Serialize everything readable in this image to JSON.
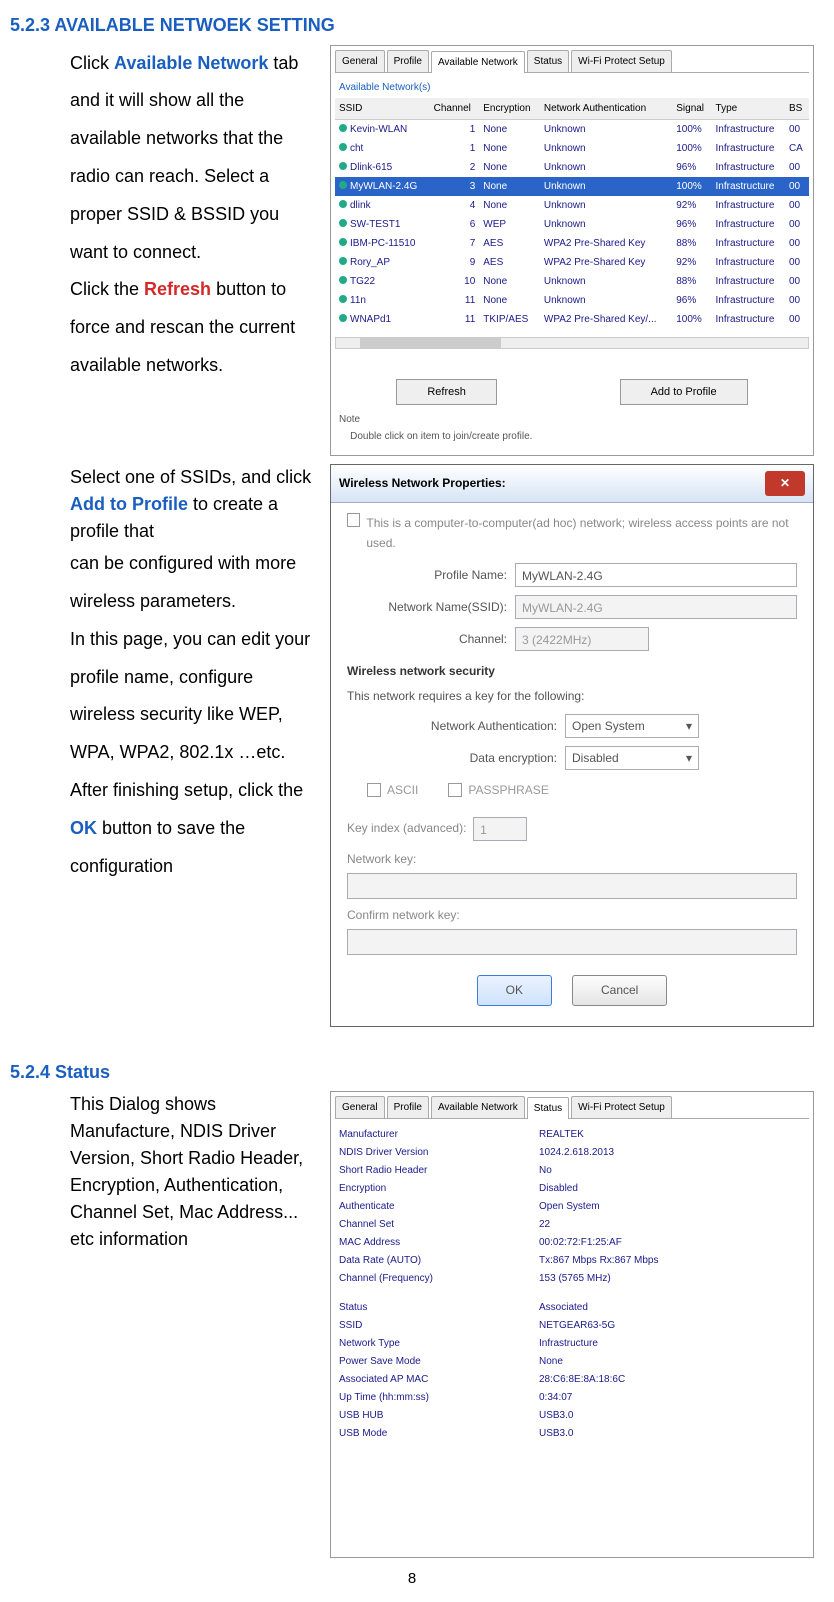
{
  "sec1_title": "5.2.3 AVAILABLE NETWOEK SETTING",
  "p1": {
    "pre": "Click ",
    "kw1": "Available Network",
    "mid1": " tab and it will show all the available networks that the radio can reach. Select a proper SSID & BSSID you want to connect.",
    "click_the": "Click the ",
    "kw2": "Refresh",
    "mid2": " button to force and rescan the current available networks."
  },
  "p2": {
    "a": "Select one of SSIDs, and click ",
    "kw": "Add to Profile",
    "b": " to create a profile that",
    "c": "can be configured with more wireless parameters.",
    "d": "In this page, you can edit your profile name, configure wireless security like WEP, WPA, WPA2, 802.1x …etc. After finishing setup, click the ",
    "ok": "OK",
    "e": " button to save the configuration"
  },
  "sec2_title": "5.2.4 Status",
  "p3": "This Dialog shows Manufacture, NDIS Driver Version, Short Radio Header, Encryption, Authentication, Channel Set, Mac Address... etc information",
  "img1": {
    "tabs": {
      "general": "General",
      "profile": "Profile",
      "avail": "Available Network",
      "status": "Status",
      "wps": "Wi-Fi Protect Setup"
    },
    "avail_label": "Available Network(s)",
    "headers": {
      "ssid": "SSID",
      "channel": "Channel",
      "enc": "Encryption",
      "auth": "Network Authentication",
      "signal": "Signal",
      "type": "Type",
      "bs": "BS"
    },
    "rows": [
      {
        "ssid": "Kevin-WLAN",
        "ch": "1",
        "enc": "None",
        "auth": "Unknown",
        "sig": "100%",
        "type": "Infrastructure",
        "bs": "00"
      },
      {
        "ssid": "cht",
        "ch": "1",
        "enc": "None",
        "auth": "Unknown",
        "sig": "100%",
        "type": "Infrastructure",
        "bs": "CA"
      },
      {
        "ssid": "Dlink-615",
        "ch": "2",
        "enc": "None",
        "auth": "Unknown",
        "sig": "96%",
        "type": "Infrastructure",
        "bs": "00"
      },
      {
        "ssid": "MyWLAN-2.4G",
        "ch": "3",
        "enc": "None",
        "auth": "Unknown",
        "sig": "100%",
        "type": "Infrastructure",
        "bs": "00",
        "sel": true
      },
      {
        "ssid": "dlink",
        "ch": "4",
        "enc": "None",
        "auth": "Unknown",
        "sig": "92%",
        "type": "Infrastructure",
        "bs": "00"
      },
      {
        "ssid": "SW-TEST1",
        "ch": "6",
        "enc": "WEP",
        "auth": "Unknown",
        "sig": "96%",
        "type": "Infrastructure",
        "bs": "00"
      },
      {
        "ssid": "IBM-PC-11510",
        "ch": "7",
        "enc": "AES",
        "auth": "WPA2 Pre-Shared Key",
        "sig": "88%",
        "type": "Infrastructure",
        "bs": "00"
      },
      {
        "ssid": "Rory_AP",
        "ch": "9",
        "enc": "AES",
        "auth": "WPA2 Pre-Shared Key",
        "sig": "92%",
        "type": "Infrastructure",
        "bs": "00"
      },
      {
        "ssid": "TG22",
        "ch": "10",
        "enc": "None",
        "auth": "Unknown",
        "sig": "88%",
        "type": "Infrastructure",
        "bs": "00"
      },
      {
        "ssid": "11n",
        "ch": "11",
        "enc": "None",
        "auth": "Unknown",
        "sig": "96%",
        "type": "Infrastructure",
        "bs": "00"
      },
      {
        "ssid": "WNAPd1",
        "ch": "11",
        "enc": "TKIP/AES",
        "auth": "WPA2 Pre-Shared Key/...",
        "sig": "100%",
        "type": "Infrastructure",
        "bs": "00"
      }
    ],
    "refresh": "Refresh",
    "add": "Add to Profile",
    "note_lbl": "Note",
    "note": "Double click on item to join/create profile."
  },
  "img2": {
    "title": "Wireless Network Properties:",
    "adhoc": "This is a computer-to-computer(ad hoc) network; wireless access points are not used.",
    "pname_lbl": "Profile Name:",
    "pname": "MyWLAN-2.4G",
    "ssid_lbl": "Network Name(SSID):",
    "ssid": "MyWLAN-2.4G",
    "ch_lbl": "Channel:",
    "ch": "3  (2422MHz)",
    "sec_hdr": "Wireless network security",
    "sec_sub": "This network requires a key for the following:",
    "auth_lbl": "Network Authentication:",
    "auth": "Open System",
    "enc_lbl": "Data encryption:",
    "enc": "Disabled",
    "ascii": "ASCII",
    "pass": "PASSPHRASE",
    "kidx": "Key index (advanced):",
    "kidxv": "1",
    "nkey": "Network key:",
    "cnkey": "Confirm network key:",
    "ok": "OK",
    "cancel": "Cancel"
  },
  "img3": {
    "tabs": {
      "general": "General",
      "profile": "Profile",
      "avail": "Available Network",
      "status": "Status",
      "wps": "Wi-Fi Protect Setup"
    },
    "rows": [
      {
        "l": "Manufacturer",
        "v": "REALTEK"
      },
      {
        "l": "NDIS Driver Version",
        "v": "1024.2.618.2013"
      },
      {
        "l": "Short Radio Header",
        "v": "No"
      },
      {
        "l": "Encryption",
        "v": "Disabled"
      },
      {
        "l": "Authenticate",
        "v": "Open System"
      },
      {
        "l": "Channel Set",
        "v": "22"
      },
      {
        "l": "MAC Address",
        "v": "00:02:72:F1:25:AF"
      },
      {
        "l": "Data Rate (AUTO)",
        "v": "Tx:867 Mbps Rx:867 Mbps"
      },
      {
        "l": "Channel (Frequency)",
        "v": "153 (5765 MHz)"
      }
    ],
    "rows2": [
      {
        "l": "Status",
        "v": "Associated"
      },
      {
        "l": "SSID",
        "v": "NETGEAR63-5G"
      },
      {
        "l": "Network Type",
        "v": "Infrastructure"
      },
      {
        "l": "Power Save Mode",
        "v": "None"
      },
      {
        "l": "Associated AP MAC",
        "v": "28:C6:8E:8A:18:6C"
      },
      {
        "l": "Up Time (hh:mm:ss)",
        "v": "0:34:07"
      },
      {
        "l": "USB HUB",
        "v": "USB3.0"
      },
      {
        "l": "USB Mode",
        "v": "USB3.0"
      }
    ]
  },
  "pagenum": "8"
}
